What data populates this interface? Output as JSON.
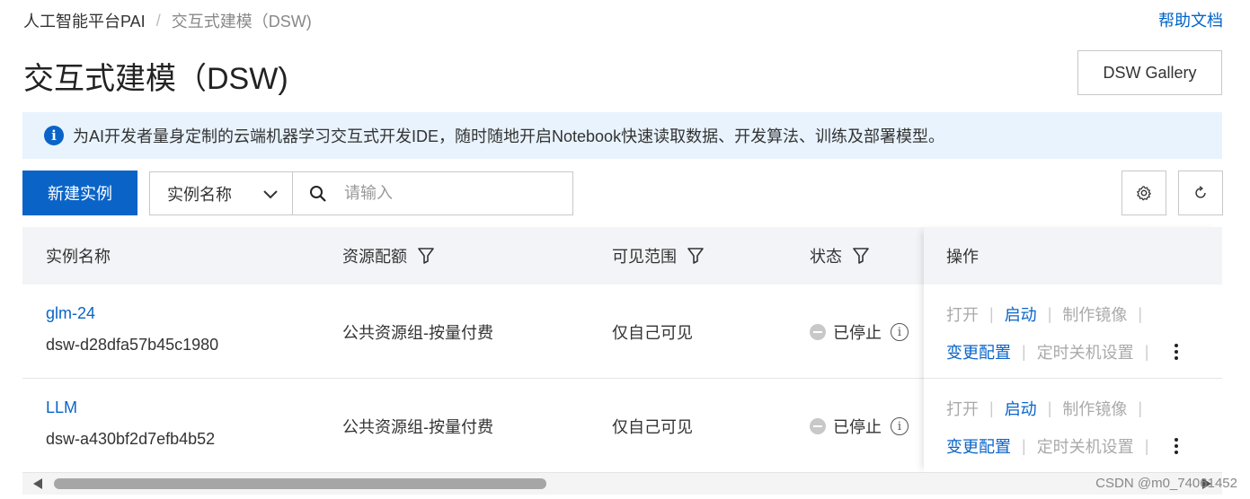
{
  "breadcrumb": {
    "root": "人工智能平台PAI",
    "separator": "/",
    "current": "交互式建模（DSW)"
  },
  "help_link": "帮助文档",
  "page_title": "交互式建模（DSW)",
  "gallery_button": "DSW Gallery",
  "notice": {
    "icon": "info-icon",
    "text": "为AI开发者量身定制的云端机器学习交互式开发IDE，随时随地开启Notebook快速读取数据、开发算法、训练及部署模型。"
  },
  "toolbar": {
    "new_instance": "新建实例",
    "search_select": "实例名称",
    "search_placeholder": "请输入",
    "settings_icon": "gear-icon",
    "refresh_icon": "refresh-icon"
  },
  "table": {
    "headers": {
      "name": "实例名称",
      "resource": "资源配额",
      "visibility": "可见范围",
      "status": "状态",
      "actions": "操作"
    },
    "rows": [
      {
        "name": "glm-24",
        "id": "dsw-d28dfa57b45c1980",
        "resource": "公共资源组-按量付费",
        "visibility": "仅自己可见",
        "status": "已停止"
      },
      {
        "name": "LLM",
        "id": "dsw-a430bf2d7efb4b52",
        "resource": "公共资源组-按量付费",
        "visibility": "仅自己可见",
        "status": "已停止"
      }
    ],
    "actions": {
      "open": "打开",
      "start": "启动",
      "make_image": "制作镜像",
      "change_config": "变更配置",
      "scheduled_shutdown": "定时关机设置"
    }
  },
  "watermark": "CSDN @m0_74061452",
  "colors": {
    "primary": "#0a64c8",
    "notice_bg": "#e8f3fd",
    "header_bg": "#f2f4f7"
  }
}
